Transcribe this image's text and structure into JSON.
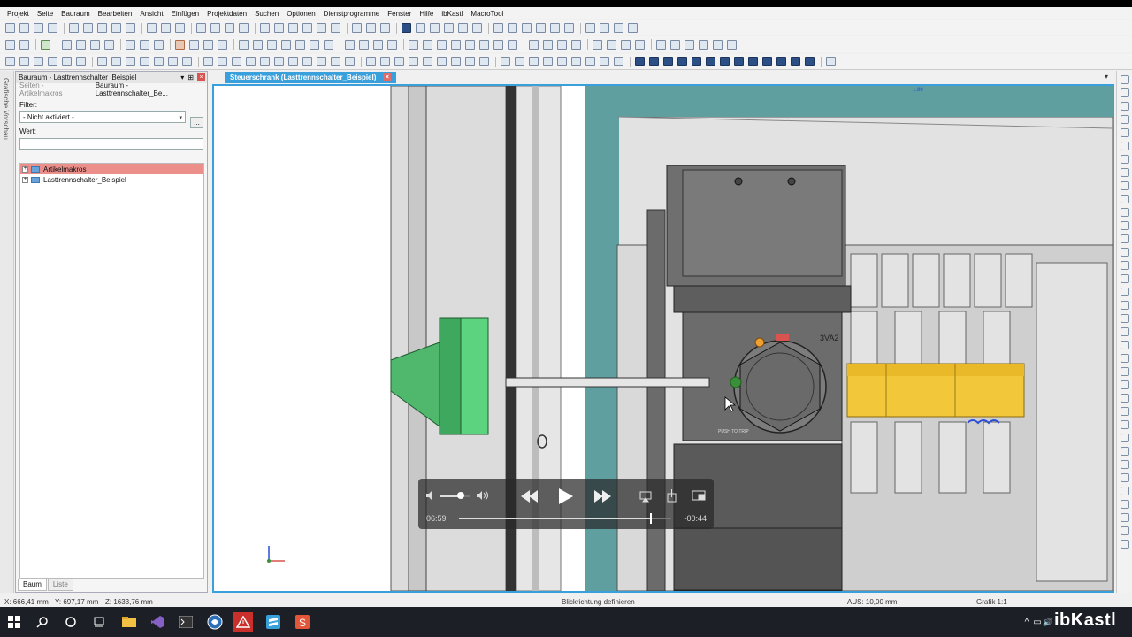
{
  "menu": {
    "items": [
      "Projekt",
      "Seite",
      "Bauraum",
      "Bearbeiten",
      "Ansicht",
      "Einfügen",
      "Projektdaten",
      "Suchen",
      "Optionen",
      "Dienstprogramme",
      "Fenster",
      "Hilfe",
      "ibKastl",
      "MacroTool"
    ]
  },
  "leftrail": {
    "label": "Grafische Vorschau"
  },
  "panel": {
    "title": "Bauraum - Lasttrennschalter_Beispiel",
    "title_ctrls": [
      "▾",
      "⊞"
    ],
    "close": "×",
    "tabs": [
      "Seiten - Artikelmakros",
      "Bauraum - Lasttrennschalter_Be..."
    ],
    "filter_label": "Filter:",
    "filter_value": "- Nicht aktiviert -",
    "filter_arrow": "▾",
    "filter_more": "...",
    "value_label": "Wert:",
    "value_text": "",
    "tree": [
      {
        "label": "Artikelmakros",
        "selected": true,
        "expander": "+"
      },
      {
        "label": "Lasttrennschalter_Beispiel",
        "selected": false,
        "expander": "+"
      }
    ],
    "bottom_tabs": [
      "Baum",
      "Liste"
    ]
  },
  "document": {
    "tab_label": "Steuerschrank (Lasttrennschalter_Beispiel)",
    "tab_close": "×",
    "dropdown": "▾",
    "scene_labels": {
      "device_label": "3VA2",
      "push_label": "PUSH TO TRIP",
      "top_readout": "1:86"
    }
  },
  "video": {
    "elapsed": "06:59",
    "remaining": "-00:44",
    "progress": 0.904,
    "volume": 0.7,
    "icons": [
      "volume-icon",
      "rewind-icon",
      "play-icon",
      "fast-forward-icon",
      "airplay-icon",
      "share-icon",
      "pip-icon"
    ]
  },
  "status": {
    "x": "X: 666,41 mm",
    "y": "Y: 697,17 mm",
    "z": "Z: 1633,76 mm",
    "view": "Blickrichtung definieren",
    "aus": "AUS: 10,00 mm",
    "grafik": "Grafik 1:1"
  },
  "taskbar": {
    "brand": "ibKastl",
    "icons": [
      "windows-start-icon",
      "search-icon",
      "cortana-icon",
      "task-view-icon",
      "file-explorer-icon",
      "visual-studio-icon",
      "terminal-icon",
      "eplan-icon",
      "warning-app-icon",
      "sublime-icon",
      "s-app-icon"
    ],
    "tray": [
      "^",
      "▭",
      "🔊"
    ]
  },
  "colors": {
    "accent": "#3aa0dc",
    "selection": "#ec8f8b",
    "handle_green": "#5bd37f",
    "bar_yellow": "#f2c83a",
    "teal": "#5f9fa0"
  }
}
